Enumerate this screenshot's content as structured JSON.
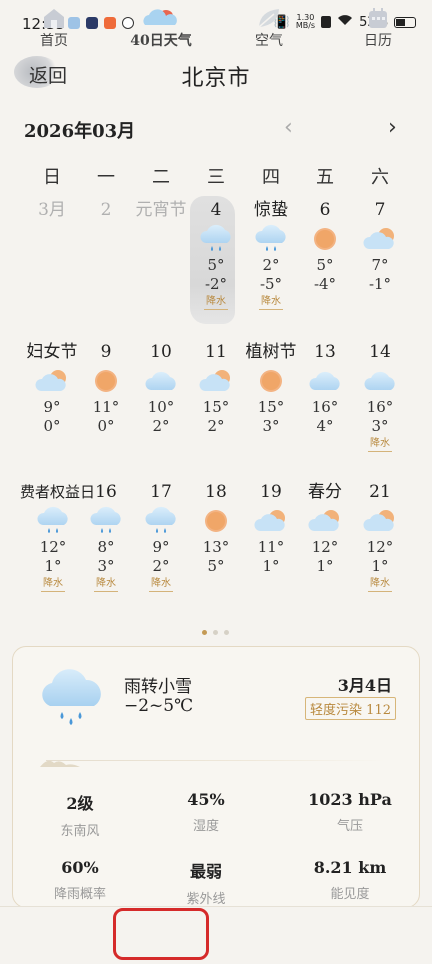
{
  "status_bar": {
    "time": "12:35",
    "speed_top": "1.30",
    "speed_bottom": "MB/s",
    "battery": "52%"
  },
  "header": {
    "back_label": "返回",
    "city": "北京市"
  },
  "calendar": {
    "month_label": "2026年03月",
    "prev_icon": "‹",
    "next_icon": "›",
    "weekdays": [
      "日",
      "一",
      "二",
      "三",
      "四",
      "五",
      "六"
    ],
    "rows": [
      [
        {
          "day": "3月",
          "gray": true
        },
        {
          "day": "2",
          "gray": true
        },
        {
          "day": "元宵节",
          "gray": true
        },
        {
          "day": "4",
          "icon": "cloud-rain",
          "high": "5°",
          "low": "-2°",
          "tag": "降水",
          "today": true
        },
        {
          "day": "惊蛰",
          "icon": "cloud-rain",
          "high": "2°",
          "low": "-5°",
          "tag": "降水"
        },
        {
          "day": "6",
          "icon": "sun",
          "high": "5°",
          "low": "-4°"
        },
        {
          "day": "7",
          "icon": "partly-cloudy",
          "high": "7°",
          "low": "-1°"
        }
      ],
      [
        {
          "day": "妇女节",
          "icon": "partly-cloudy",
          "high": "9°",
          "low": "0°"
        },
        {
          "day": "9",
          "icon": "sun",
          "high": "11°",
          "low": "0°"
        },
        {
          "day": "10",
          "icon": "cloud",
          "high": "10°",
          "low": "2°"
        },
        {
          "day": "11",
          "icon": "partly-cloudy",
          "high": "15°",
          "low": "2°"
        },
        {
          "day": "植树节",
          "icon": "sun",
          "high": "15°",
          "low": "3°"
        },
        {
          "day": "13",
          "icon": "cloud",
          "high": "16°",
          "low": "4°"
        },
        {
          "day": "14",
          "icon": "cloud",
          "high": "16°",
          "low": "3°",
          "tag": "降水"
        }
      ],
      [
        {
          "day": "费者权益日",
          "icon": "cloud-rain",
          "high": "12°",
          "low": "1°",
          "tag": "降水"
        },
        {
          "day": "16",
          "icon": "cloud-rain",
          "high": "8°",
          "low": "3°",
          "tag": "降水"
        },
        {
          "day": "17",
          "icon": "cloud-rain",
          "high": "9°",
          "low": "2°",
          "tag": "降水"
        },
        {
          "day": "18",
          "icon": "sun",
          "high": "13°",
          "low": "5°"
        },
        {
          "day": "19",
          "icon": "partly-cloudy",
          "high": "11°",
          "low": "1°"
        },
        {
          "day": "春分",
          "icon": "partly-cloudy",
          "high": "12°",
          "low": "1°"
        },
        {
          "day": "21",
          "icon": "partly-cloudy",
          "high": "12°",
          "low": "1°",
          "tag": "降水"
        }
      ]
    ]
  },
  "detail": {
    "condition": "雨转小雪",
    "temp_range": "−2~5℃",
    "date": "3月4日",
    "aqi": "轻度污染 112",
    "stats": [
      {
        "value": "2级",
        "label": "东南风"
      },
      {
        "value": "45%",
        "label": "湿度"
      },
      {
        "value": "1023 hPa",
        "label": "气压"
      },
      {
        "value": "60%",
        "label": "降雨概率"
      },
      {
        "value": "最弱",
        "label": "紫外线"
      },
      {
        "value": "8.21 km",
        "label": "能见度"
      }
    ]
  },
  "nav": {
    "items": [
      {
        "label": "首页",
        "icon": "home-icon"
      },
      {
        "label": "40日天气",
        "icon": "cloud-icon"
      },
      {
        "label": "空气",
        "icon": "leaf-icon"
      },
      {
        "label": "日历",
        "icon": "calendar-icon"
      }
    ]
  },
  "colors": {
    "accent": "#c49a55",
    "highlight": "#d52a2a",
    "sun": "#f0a668",
    "cloud": "#bcdcf3"
  }
}
